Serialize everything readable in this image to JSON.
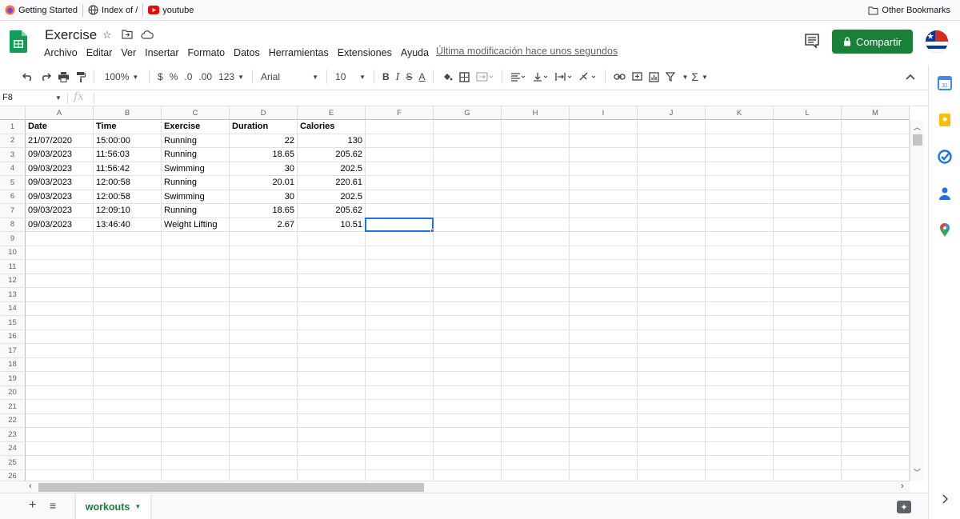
{
  "bookmarks": {
    "items": [
      "Getting Started",
      "Index of /",
      "youtube"
    ],
    "other": "Other Bookmarks"
  },
  "document": {
    "title": "Exercise",
    "last_edit": "Última modificación hace unos segundos"
  },
  "menu": [
    "Archivo",
    "Editar",
    "Ver",
    "Insertar",
    "Formato",
    "Datos",
    "Herramientas",
    "Extensiones",
    "Ayuda"
  ],
  "share": {
    "label": "Compartir"
  },
  "toolbar": {
    "zoom": "100%",
    "currency": "$",
    "percent": "%",
    "dec_decrease": ".0",
    "dec_increase": ".00",
    "format_more": "123",
    "font": "Arial",
    "font_size": "10",
    "bold": "B",
    "italic": "I",
    "strike": "S",
    "text_color": "A"
  },
  "formula_bar": {
    "cell_ref": "F8",
    "fx": "fx",
    "value": ""
  },
  "grid": {
    "columns": [
      "A",
      "B",
      "C",
      "D",
      "E",
      "F",
      "G",
      "H",
      "I",
      "J",
      "K",
      "L",
      "M"
    ],
    "rows": [
      "1",
      "2",
      "3",
      "4",
      "5",
      "6",
      "7",
      "8",
      "9",
      "10",
      "11",
      "12",
      "13",
      "14",
      "15",
      "16",
      "17",
      "18",
      "19",
      "20",
      "21",
      "22",
      "23",
      "24",
      "25",
      "26"
    ],
    "header_row": [
      "Date",
      "Time",
      "Exercise",
      "Duration",
      "Calories"
    ],
    "data": [
      [
        "21/07/2020",
        "15:00:00",
        "Running",
        "22",
        "130"
      ],
      [
        "09/03/2023",
        "11:56:03",
        "Running",
        "18.65",
        "205.62"
      ],
      [
        "09/03/2023",
        "11:56:42",
        "Swimming",
        "30",
        "202.5"
      ],
      [
        "09/03/2023",
        "12:00:58",
        "Running",
        "20.01",
        "220.61"
      ],
      [
        "09/03/2023",
        "12:00:58",
        "Swimming",
        "30",
        "202.5"
      ],
      [
        "09/03/2023",
        "12:09:10",
        "Running",
        "18.65",
        "205.62"
      ],
      [
        "09/03/2023",
        "13:46:40",
        "Weight Lifting",
        "2.67",
        "10.51"
      ]
    ],
    "selected_cell": "F8"
  },
  "sheet_tab": {
    "name": "workouts"
  },
  "colors": {
    "brand_green": "#188038",
    "selection_blue": "#1a73e8"
  }
}
